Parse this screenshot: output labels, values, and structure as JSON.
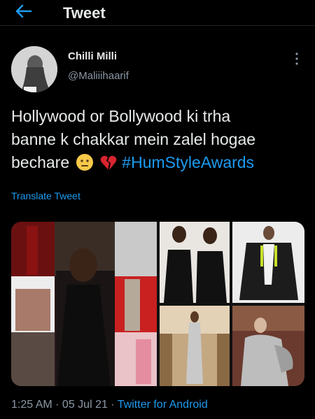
{
  "header": {
    "title": "Tweet"
  },
  "tweet": {
    "display_name": "Chilli Milli",
    "handle": "@Maliiihaarif",
    "text_line1": "Hollywood or Bollywood ki trha",
    "text_line2": "banne k chakkar mein zalel hogae",
    "text_line3": "bechare",
    "hashtag": "#HumStyleAwards",
    "translate_label": "Translate Tweet",
    "time": "1:25 AM",
    "separator": " · ",
    "date": "05 Jul 21",
    "source": "Twitter for Android"
  },
  "colors": {
    "background": "#000000",
    "text": "#e7e9ea",
    "secondary": "#8b98a5",
    "accent": "#1d9bf0"
  },
  "icons": {
    "back": "arrow-left-icon",
    "more": "more-vertical-icon",
    "emoji_1": "neutral-face-emoji",
    "emoji_2": "broken-heart-emoji"
  }
}
